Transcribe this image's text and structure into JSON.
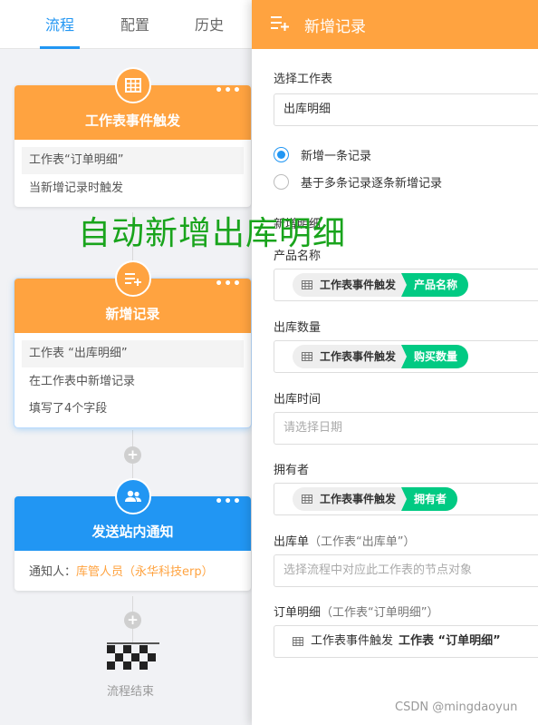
{
  "tabs": [
    {
      "label": "流程",
      "active": true
    },
    {
      "label": "配置",
      "active": false
    },
    {
      "label": "历史",
      "active": false
    }
  ],
  "flow": {
    "trigger": {
      "title": "工作表事件触发",
      "more": "•••",
      "sheet": "工作表“订单明细”",
      "desc": "当新增记录时触发",
      "icon": "table-icon"
    },
    "add_record": {
      "title": "新增记录",
      "more": "•••",
      "sheet": "工作表 “出库明细”",
      "line1": "在工作表中新增记录",
      "line2": "填写了4个字段",
      "icon": "add-record-icon"
    },
    "notify": {
      "title": "发送站内通知",
      "more": "•••",
      "recipient_label": "通知人：",
      "recipient": "库管人员（永华科技erp）",
      "icon": "users-icon"
    },
    "plus_glyph": "+",
    "end_label": "流程结束"
  },
  "overlay_text": "自动新增出库明细",
  "panel": {
    "title": "新增记录",
    "select_sheet_label": "选择工作表",
    "select_sheet_value": "出库明细",
    "radio_single": "新增一条记录",
    "radio_multi": "基于多条记录逐条新增记录",
    "section_label": "新增明细",
    "fields": {
      "product_label": "产品名称",
      "product_source": "工作表事件触发",
      "product_field": "产品名称",
      "qty_label": "出库数量",
      "qty_source": "工作表事件触发",
      "qty_field": "购买数量",
      "time_label": "出库时间",
      "time_placeholder": "请选择日期",
      "owner_label": "拥有者",
      "owner_source": "工作表事件触发",
      "owner_field": "拥有者",
      "outbound_label": "出库单",
      "outbound_hint": "（工作表“出库单”）",
      "outbound_placeholder": "选择流程中对应此工作表的节点对象",
      "order_label": "订单明细",
      "order_hint": "（工作表“订单明细”）",
      "order_source": "工作表事件触发",
      "order_value": "工作表 “订单明细”"
    }
  },
  "watermark": "CSDN @mingdaoyun",
  "colors": {
    "accent": "#2196f3",
    "orange": "#ffa340",
    "green": "#01ca83",
    "overlay_green": "#19a41c"
  }
}
